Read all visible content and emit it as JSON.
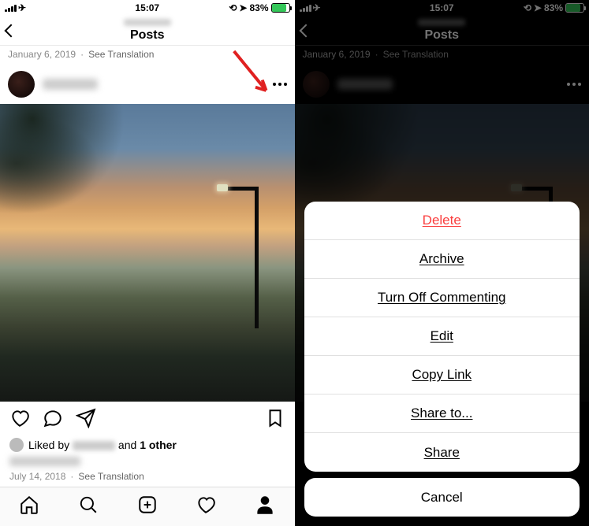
{
  "status": {
    "time": "15:07",
    "battery_pct": "83%"
  },
  "header": {
    "title": "Posts"
  },
  "top_meta": {
    "date": "January 6, 2019",
    "translation": "See Translation"
  },
  "liked": {
    "prefix": "Liked by",
    "and": " and ",
    "other": "1 other"
  },
  "bottom_meta": {
    "date": "July 14, 2018",
    "translation": "See Translation"
  },
  "sheet": {
    "items": [
      {
        "label": "Delete",
        "destructive": true,
        "underline": true,
        "name": "sheet-delete"
      },
      {
        "label": "Archive",
        "destructive": false,
        "underline": true,
        "name": "sheet-archive"
      },
      {
        "label": "Turn Off Commenting",
        "destructive": false,
        "underline": true,
        "name": "sheet-turn-off-commenting"
      },
      {
        "label": "Edit",
        "destructive": false,
        "underline": true,
        "name": "sheet-edit"
      },
      {
        "label": "Copy Link",
        "destructive": false,
        "underline": true,
        "name": "sheet-copy-link"
      },
      {
        "label": "Share to...",
        "destructive": false,
        "underline": true,
        "name": "sheet-share-to"
      },
      {
        "label": "Share",
        "destructive": false,
        "underline": true,
        "name": "sheet-share"
      }
    ],
    "cancel": "Cancel"
  }
}
